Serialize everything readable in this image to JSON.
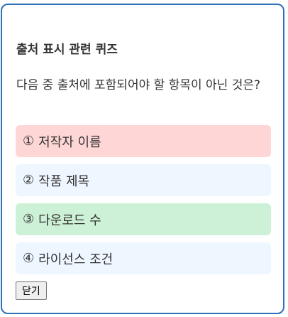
{
  "quiz": {
    "title": "출처 표시 관련 퀴즈",
    "question": "다음 중 출처에 포함되어야 할 항목이 아닌 것은?",
    "options": [
      {
        "num": "①",
        "label": "저작자 이름",
        "state": "incorrect",
        "color": "#ffd6d6"
      },
      {
        "num": "②",
        "label": "작품 제목",
        "state": "neutral",
        "color": "#eef6ff"
      },
      {
        "num": "③",
        "label": "다운로드 수",
        "state": "correct",
        "color": "#cdf1d6"
      },
      {
        "num": "④",
        "label": "라이선스 조건",
        "state": "neutral",
        "color": "#eef6ff"
      }
    ],
    "close_label": "닫기"
  },
  "colors": {
    "border": "#2e6fb8",
    "text": "#333333"
  }
}
